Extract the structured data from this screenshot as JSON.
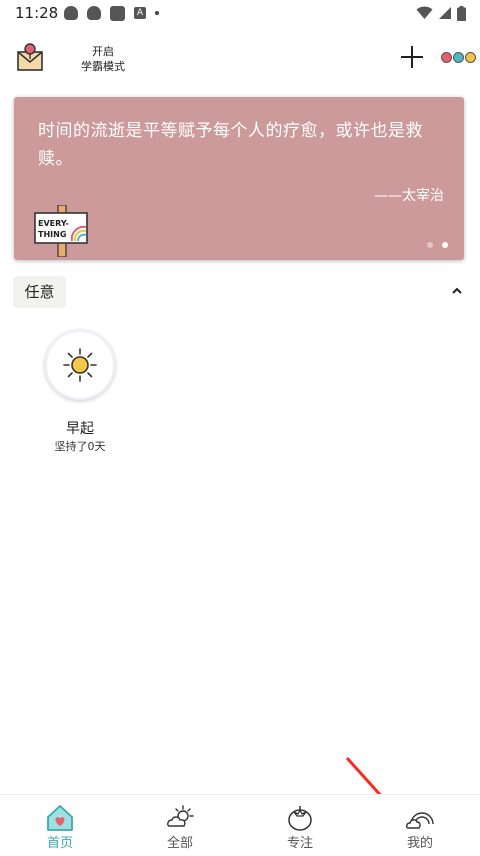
{
  "status_bar": {
    "time": "11:28",
    "left_icons": [
      "qq-icon",
      "qq-icon",
      "app-icon",
      "a-icon",
      "dot-icon"
    ],
    "a_icon_glyph": "A",
    "right_icons": [
      "wifi-icon",
      "signal-icon",
      "battery-icon"
    ]
  },
  "header": {
    "mode_label_line1": "开启",
    "mode_label_line2": "学霸模式",
    "add_icon": "plus-icon",
    "more_icon": "three-dots-icon",
    "more_dot_colors": [
      "#e5606e",
      "#4fb8c5",
      "#f3c441"
    ]
  },
  "quote": {
    "text": "时间的流逝是平等赋予每个人的疗愈，或许也是救赎。",
    "author": "——太宰治",
    "sign_text_line1": "EVERY-",
    "sign_text_line2": "THING",
    "background_color": "#cc9a9b",
    "page_count": 2,
    "active_page": 2
  },
  "category": {
    "label": "任意",
    "collapse_icon": "chevron-up-icon"
  },
  "habits": [
    {
      "name": "早起",
      "streak": "坚持了0天",
      "icon": "sun-icon"
    }
  ],
  "bottom_nav": {
    "items": [
      {
        "label": "首页",
        "icon": "home-heart-icon",
        "active": true
      },
      {
        "label": "全部",
        "icon": "cloud-sun-icon",
        "active": false
      },
      {
        "label": "专注",
        "icon": "tomato-icon",
        "active": false
      },
      {
        "label": "我的",
        "icon": "cloud-rainbow-icon",
        "active": false
      }
    ],
    "active_color": "#3aa9b0"
  },
  "annotation": {
    "arrow_color": "#ff2a1f",
    "target": "我的"
  }
}
